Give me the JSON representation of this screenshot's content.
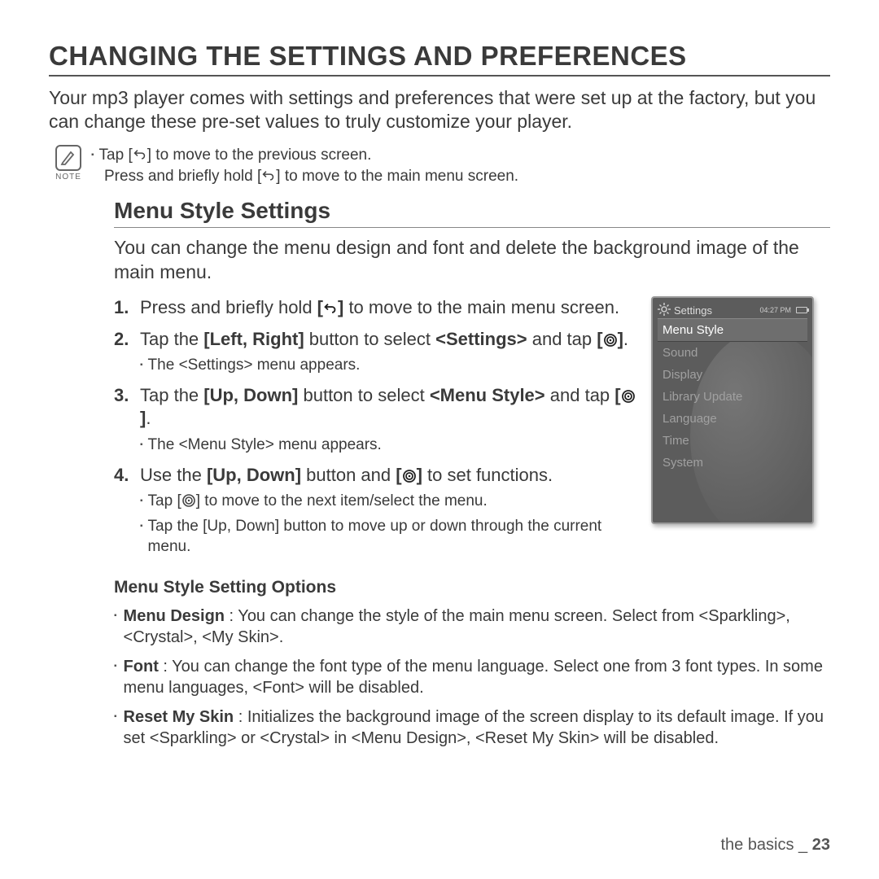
{
  "title": "CHANGING THE SETTINGS AND PREFERENCES",
  "intro": "Your mp3 player comes with settings and preferences that were set up at the factory, but you can change these pre-set values to truly customize your player.",
  "note": {
    "label": "NOTE",
    "line1_pre": "Tap [",
    "line1_post": "] to move to the previous screen.",
    "line2_pre": "Press and briefly hold [",
    "line2_post": "] to move to the main menu screen."
  },
  "section_title": "Menu Style Settings",
  "section_intro": "You can change the menu design and font and delete the background image of the main menu.",
  "steps": {
    "s1": {
      "n": "1.",
      "pre": "Press and briefly hold ",
      "b1": "[",
      "b1post": "]",
      "post": " to move to the main menu screen."
    },
    "s2": {
      "n": "2.",
      "pre": "Tap the ",
      "b1": "[Left, Right]",
      "mid": " button to select ",
      "b2": "<Settings>",
      "mid2": " and tap ",
      "b3": "[",
      "b3post": "]",
      "post": ".",
      "sub": "The <Settings> menu appears."
    },
    "s3": {
      "n": "3.",
      "pre": "Tap the ",
      "b1": "[Up, Down]",
      "mid": " button to select ",
      "b2": "<Menu Style>",
      "mid2": " and tap ",
      "b3": "[",
      "b3post": "]",
      "post": ".",
      "sub": "The <Menu Style> menu appears."
    },
    "s4": {
      "n": "4.",
      "pre": "Use the ",
      "b1": "[Up, Down]",
      "mid": " button and ",
      "b2": "[",
      "b2post": "]",
      "post": " to set functions.",
      "sub1_pre": "Tap [",
      "sub1_post": "] to move to the next item/select the menu.",
      "sub2": "Tap the [Up, Down] button to move up or down through the current menu."
    }
  },
  "device": {
    "header": "Settings",
    "time": "04:27 PM",
    "items": [
      "Menu Style",
      "Sound",
      "Display",
      "Library Update",
      "Language",
      "Time",
      "System"
    ],
    "selected": 0
  },
  "options_title": "Menu Style Setting Options",
  "options": {
    "o1": {
      "b": "Menu Design",
      "t": " : You can change the style of the main menu screen. Select from <Sparkling>, <Crystal>, <My Skin>."
    },
    "o2": {
      "b": "Font",
      "t": " : You can change the font type of the menu language. Select one from 3 font types. In some menu languages, <Font> will be disabled."
    },
    "o3": {
      "b": "Reset My Skin",
      "t": " : Initializes the background image of the screen display to its default image. If you set <Sparkling> or <Crystal> in <Menu Design>, <Reset My Skin> will be disabled."
    }
  },
  "footer": {
    "section": "the basics _ ",
    "page": "23"
  }
}
